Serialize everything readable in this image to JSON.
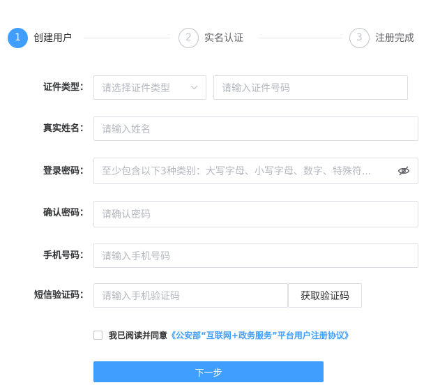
{
  "steps": [
    {
      "number": "1",
      "label": "创建用户",
      "active": true
    },
    {
      "number": "2",
      "label": "实名认证",
      "active": false
    },
    {
      "number": "3",
      "label": "注册完成",
      "active": false
    }
  ],
  "form": {
    "id_type": {
      "label": "证件类型：",
      "placeholder": "请选择证件类型"
    },
    "id_number": {
      "placeholder": "请输入证件号码"
    },
    "real_name": {
      "label": "真实姓名：",
      "placeholder": "请输入姓名"
    },
    "password": {
      "label": "登录密码：",
      "placeholder": "至少包含以下3种类别：大写字母、小写字母、数字、特殊符..."
    },
    "confirm_password": {
      "label": "确认密码：",
      "placeholder": "请确认密码"
    },
    "phone": {
      "label": "手机号码：",
      "placeholder": "请输入手机号码"
    },
    "sms_code": {
      "label": "短信验证码：",
      "placeholder": "请输入手机验证码",
      "button": "获取验证码"
    }
  },
  "agreement": {
    "text": "我已阅读并同意",
    "link": "《公安部“互联网+政务服务”平台用户注册协议》"
  },
  "next_button": "下一步",
  "colors": {
    "accent": "#409eff",
    "border": "#dcdfe6",
    "placeholder": "#b4b8c0"
  }
}
